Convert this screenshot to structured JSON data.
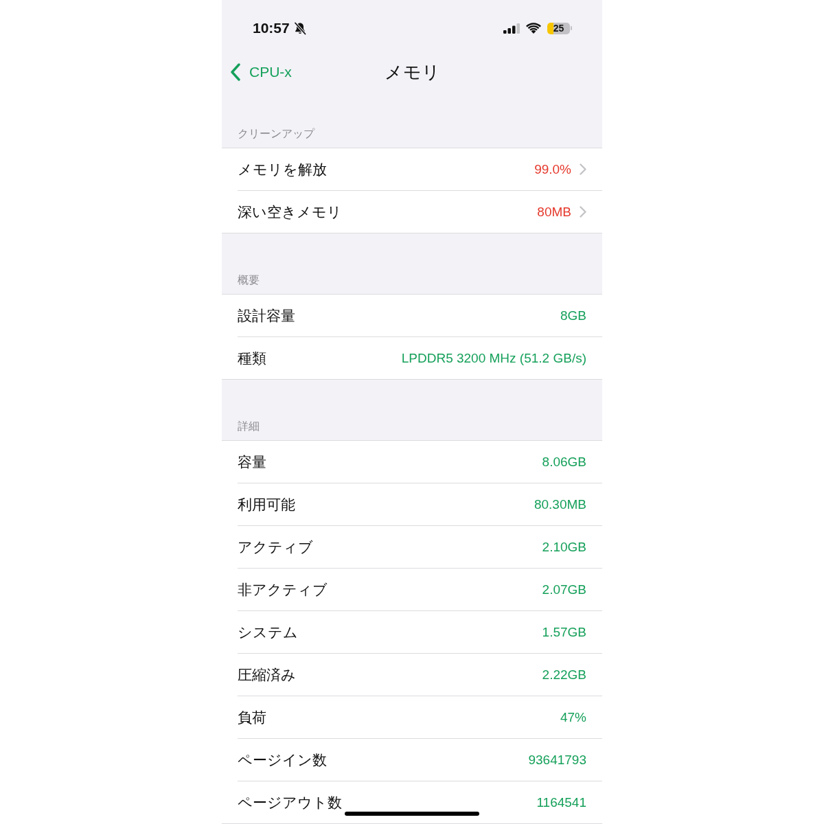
{
  "status_bar": {
    "time": "10:57",
    "silent": true,
    "battery": "25"
  },
  "nav": {
    "back": "CPU-x",
    "title": "メモリ"
  },
  "sections": [
    {
      "header": "クリーンアップ",
      "rows": [
        {
          "label": "メモリを解放",
          "value": "99.0%",
          "color": "#e5392c",
          "disclosure": true
        },
        {
          "label": "深い空きメモリ",
          "value": "80MB",
          "color": "#e5392c",
          "disclosure": true
        }
      ]
    },
    {
      "header": "概要",
      "rows": [
        {
          "label": "設計容量",
          "value": "8GB",
          "color": "#15a05a",
          "disclosure": false
        },
        {
          "label": "種類",
          "value": "LPDDR5 3200 MHz (51.2 GB/s)",
          "color": "#15a05a",
          "disclosure": false
        }
      ]
    },
    {
      "header": "詳細",
      "rows": [
        {
          "label": "容量",
          "value": "8.06GB",
          "color": "#15a05a",
          "disclosure": false
        },
        {
          "label": "利用可能",
          "value": "80.30MB",
          "color": "#15a05a",
          "disclosure": false
        },
        {
          "label": "アクティブ",
          "value": "2.10GB",
          "color": "#15a05a",
          "disclosure": false
        },
        {
          "label": "非アクティブ",
          "value": "2.07GB",
          "color": "#15a05a",
          "disclosure": false
        },
        {
          "label": "システム",
          "value": "1.57GB",
          "color": "#15a05a",
          "disclosure": false
        },
        {
          "label": "圧縮済み",
          "value": "2.22GB",
          "color": "#15a05a",
          "disclosure": false
        },
        {
          "label": "負荷",
          "value": "47%",
          "color": "#15a05a",
          "disclosure": false
        },
        {
          "label": "ページイン数",
          "value": "93641793",
          "color": "#15a05a",
          "disclosure": false
        },
        {
          "label": "ページアウト数",
          "value": "1164541",
          "color": "#15a05a",
          "disclosure": false
        }
      ]
    }
  ]
}
